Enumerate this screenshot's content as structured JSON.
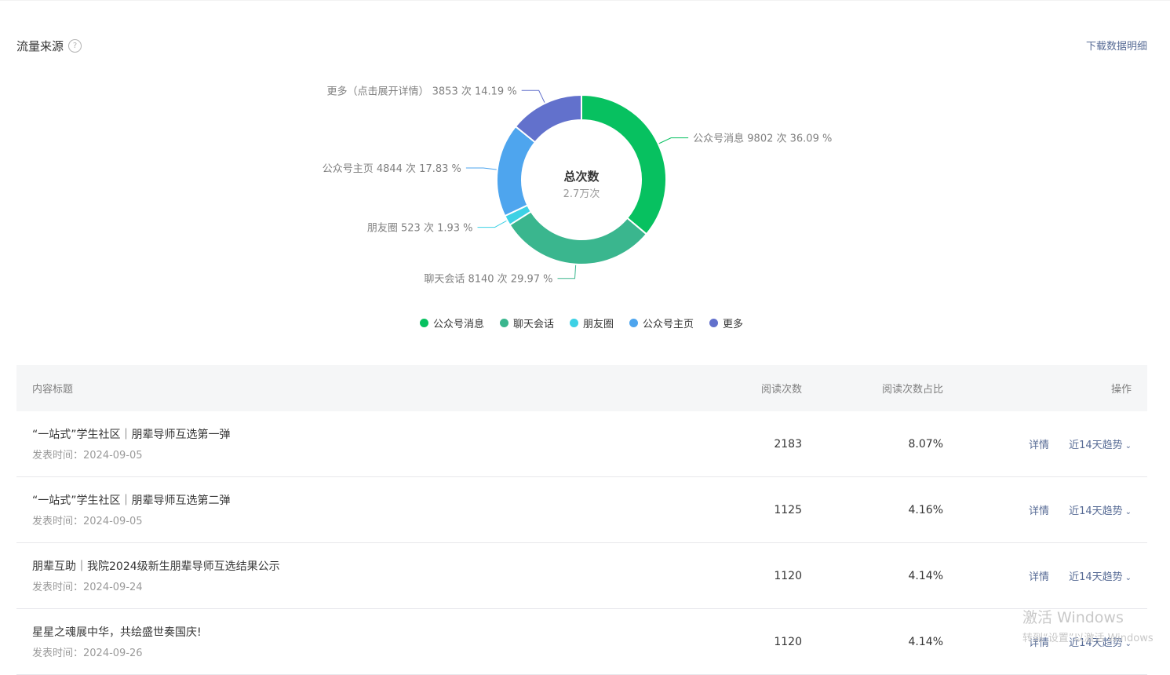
{
  "section": {
    "title": "流量来源",
    "help_icon": "?"
  },
  "download_link": "下载数据明细",
  "chart_data": {
    "type": "pie",
    "center_title": "总次数",
    "center_value": "2.7万次",
    "slices": [
      {
        "name": "公众号消息",
        "value": 9802,
        "percent": 36.09,
        "color": "#07c160",
        "label": "公众号消息 9802 次 36.09 %"
      },
      {
        "name": "聊天会话",
        "value": 8140,
        "percent": 29.97,
        "color": "#3ab68e",
        "label": "聊天会话 8140 次 29.97 %"
      },
      {
        "name": "朋友圈",
        "value": 523,
        "percent": 1.93,
        "color": "#3dd1e5",
        "label": "朋友圈 523 次 1.93 %"
      },
      {
        "name": "公众号主页",
        "value": 4844,
        "percent": 17.83,
        "color": "#4ea5ee",
        "label": "公众号主页 4844 次 17.83 %"
      },
      {
        "name": "更多",
        "value": 3853,
        "percent": 14.19,
        "color": "#6271cc",
        "label": "更多（点击展开详情） 3853 次 14.19 %"
      }
    ]
  },
  "table": {
    "headers": {
      "title": "内容标题",
      "reads": "阅读次数",
      "ratio": "阅读次数占比",
      "ops": "操作"
    },
    "rows": [
      {
        "title": "“一站式”学生社区｜朋辈导师互选第一弹",
        "date": "发表时间：2024-09-05",
        "reads": "2183",
        "ratio": "8.07%",
        "detail": "详情",
        "trend": "近14天趋势"
      },
      {
        "title": "“一站式”学生社区｜朋辈导师互选第二弹",
        "date": "发表时间：2024-09-05",
        "reads": "1125",
        "ratio": "4.16%",
        "detail": "详情",
        "trend": "近14天趋势"
      },
      {
        "title": "朋辈互助｜我院2024级新生朋辈导师互选结果公示",
        "date": "发表时间：2024-09-24",
        "reads": "1120",
        "ratio": "4.14%",
        "detail": "详情",
        "trend": "近14天趋势"
      },
      {
        "title": "星星之魂展中华，共绘盛世奏国庆!",
        "date": "发表时间：2024-09-26",
        "reads": "1120",
        "ratio": "4.14%",
        "detail": "详情",
        "trend": "近14天趋势"
      }
    ]
  },
  "watermark": {
    "line1": "激活 Windows",
    "line2": "转到“设置”以激活 Windows"
  }
}
